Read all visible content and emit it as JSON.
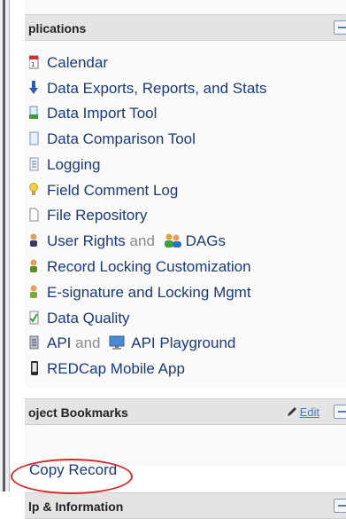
{
  "applications": {
    "title": "plications",
    "items": [
      {
        "label": "Calendar"
      },
      {
        "label": "Data Exports, Reports, and Stats"
      },
      {
        "label": "Data Import Tool"
      },
      {
        "label": "Data Comparison Tool"
      },
      {
        "label": "Logging"
      },
      {
        "label": "Field Comment Log"
      },
      {
        "label": "File Repository"
      },
      {
        "label": "User Rights",
        "joiner": "and",
        "label2": "DAGs"
      },
      {
        "label": "Record Locking Customization"
      },
      {
        "label": "E-signature and Locking Mgmt"
      },
      {
        "label": "Data Quality"
      },
      {
        "label": "API",
        "joiner": "and",
        "label2": "API Playground"
      },
      {
        "label": "REDCap Mobile App"
      }
    ]
  },
  "bookmarks": {
    "title": "oject Bookmarks",
    "edit_label": "Edit",
    "items": [
      {
        "label": "Copy Record"
      }
    ]
  },
  "help": {
    "title": "lp & Information"
  },
  "colors": {
    "link": "#1a3a78",
    "header_bg": "#e4e4e4",
    "highlight_ring": "#d42a2a"
  }
}
